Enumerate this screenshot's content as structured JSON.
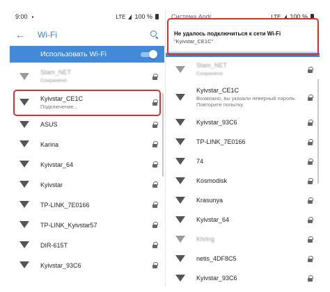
{
  "colors": {
    "accent": "#4289d8",
    "highlight": "#d9312c"
  },
  "left": {
    "status": {
      "time": "9:00",
      "battery": "100 %",
      "network": "LTE"
    },
    "title": "Wi-Fi",
    "toggle_label": "Использовать Wi-Fi",
    "networks": [
      {
        "name": "Stam_NET",
        "sub": "Сохранено",
        "blurred": true
      },
      {
        "name": "Kyivstar_CE1C",
        "sub": "Подключение..."
      },
      {
        "name": "ASUS"
      },
      {
        "name": "Karina"
      },
      {
        "name": "Kyivstar_64"
      },
      {
        "name": "Kyivstar"
      },
      {
        "name": "TP-LINK_7E0166"
      },
      {
        "name": "TP-LINK_Kyivstar57"
      },
      {
        "name": "DIR-615T"
      },
      {
        "name": "Kyivstar_93C6"
      }
    ]
  },
  "right": {
    "status": {
      "app": "Система Andr..",
      "battery": "100 %",
      "network": "LTE"
    },
    "dialog": {
      "title": "Не удалось подключиться к сети Wi-Fi",
      "subtitle": "\"Kyivstar_CE1C\""
    },
    "networks": [
      {
        "name": "Stam_NET",
        "sub": "Сохранено",
        "blurred": true
      },
      {
        "name": "Kyivstar_CE1C",
        "sub": "Возможно, вы указали неверный пароль. Повторите попытку."
      },
      {
        "name": "Kyivstar_93C6"
      },
      {
        "name": "TP-LINK_7E0166"
      },
      {
        "name": "74"
      },
      {
        "name": "Kosmodisk"
      },
      {
        "name": "Krasunya"
      },
      {
        "name": "Kyivstar_64"
      },
      {
        "name": "Khrlng",
        "blurred": true
      },
      {
        "name": "netis_4DF8C5"
      },
      {
        "name": "Kyivstar_93C6"
      }
    ]
  }
}
